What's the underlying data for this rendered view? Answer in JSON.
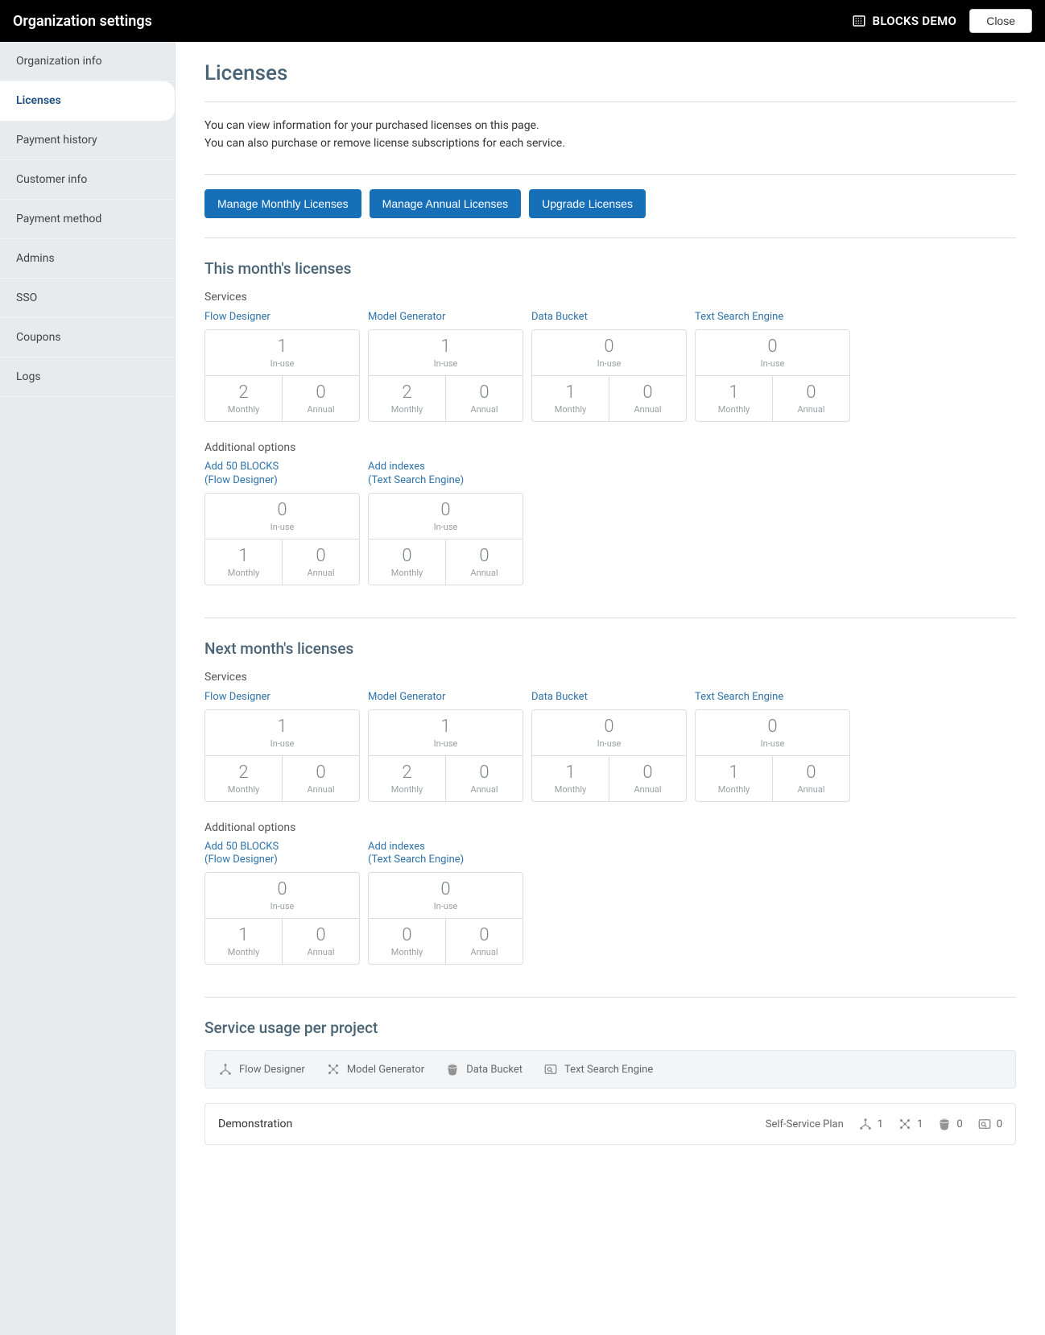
{
  "topbar": {
    "title": "Organization settings",
    "org_name": "BLOCKS DEMO",
    "close_label": "Close"
  },
  "sidebar": {
    "items": [
      "Organization info",
      "Licenses",
      "Payment history",
      "Customer info",
      "Payment method",
      "Admins",
      "SSO",
      "Coupons",
      "Logs"
    ],
    "active_index": 1
  },
  "page": {
    "title": "Licenses",
    "desc_line1": "You can view information for your purchased licenses on this page.",
    "desc_line2": "You can also purchase or remove license subscriptions for each service.",
    "buttons": {
      "manage_monthly": "Manage Monthly Licenses",
      "manage_annual": "Manage Annual Licenses",
      "upgrade": "Upgrade Licenses"
    }
  },
  "labels": {
    "services": "Services",
    "additional_options": "Additional options",
    "in_use": "In-use",
    "monthly": "Monthly",
    "annual": "Annual",
    "this_month": "This month's licenses",
    "next_month": "Next month's licenses",
    "service_usage": "Service usage per project"
  },
  "service_names": {
    "flow_designer": "Flow Designer",
    "model_generator": "Model Generator",
    "data_bucket": "Data Bucket",
    "text_search": "Text Search Engine"
  },
  "addon_names": {
    "add_blocks_l1": "Add 50 BLOCKS",
    "add_blocks_l2": "(Flow Designer)",
    "add_indexes_l1": "Add indexes",
    "add_indexes_l2": "(Text Search Engine)"
  },
  "this_month": {
    "services": [
      {
        "name_key": "flow_designer",
        "in_use": 1,
        "monthly": 2,
        "annual": 0
      },
      {
        "name_key": "model_generator",
        "in_use": 1,
        "monthly": 2,
        "annual": 0
      },
      {
        "name_key": "data_bucket",
        "in_use": 0,
        "monthly": 1,
        "annual": 0
      },
      {
        "name_key": "text_search",
        "in_use": 0,
        "monthly": 1,
        "annual": 0
      }
    ],
    "addons": [
      {
        "name_key": "add_blocks",
        "in_use": 0,
        "monthly": 1,
        "annual": 0
      },
      {
        "name_key": "add_indexes",
        "in_use": 0,
        "monthly": 0,
        "annual": 0
      }
    ]
  },
  "next_month": {
    "services": [
      {
        "name_key": "flow_designer",
        "in_use": 1,
        "monthly": 2,
        "annual": 0
      },
      {
        "name_key": "model_generator",
        "in_use": 1,
        "monthly": 2,
        "annual": 0
      },
      {
        "name_key": "data_bucket",
        "in_use": 0,
        "monthly": 1,
        "annual": 0
      },
      {
        "name_key": "text_search",
        "in_use": 0,
        "monthly": 1,
        "annual": 0
      }
    ],
    "addons": [
      {
        "name_key": "add_blocks",
        "in_use": 0,
        "monthly": 1,
        "annual": 0
      },
      {
        "name_key": "add_indexes",
        "in_use": 0,
        "monthly": 0,
        "annual": 0
      }
    ]
  },
  "projects": [
    {
      "name": "Demonstration",
      "plan": "Self-Service Plan",
      "flow_designer": 1,
      "model_generator": 1,
      "data_bucket": 0,
      "text_search": 0
    }
  ]
}
